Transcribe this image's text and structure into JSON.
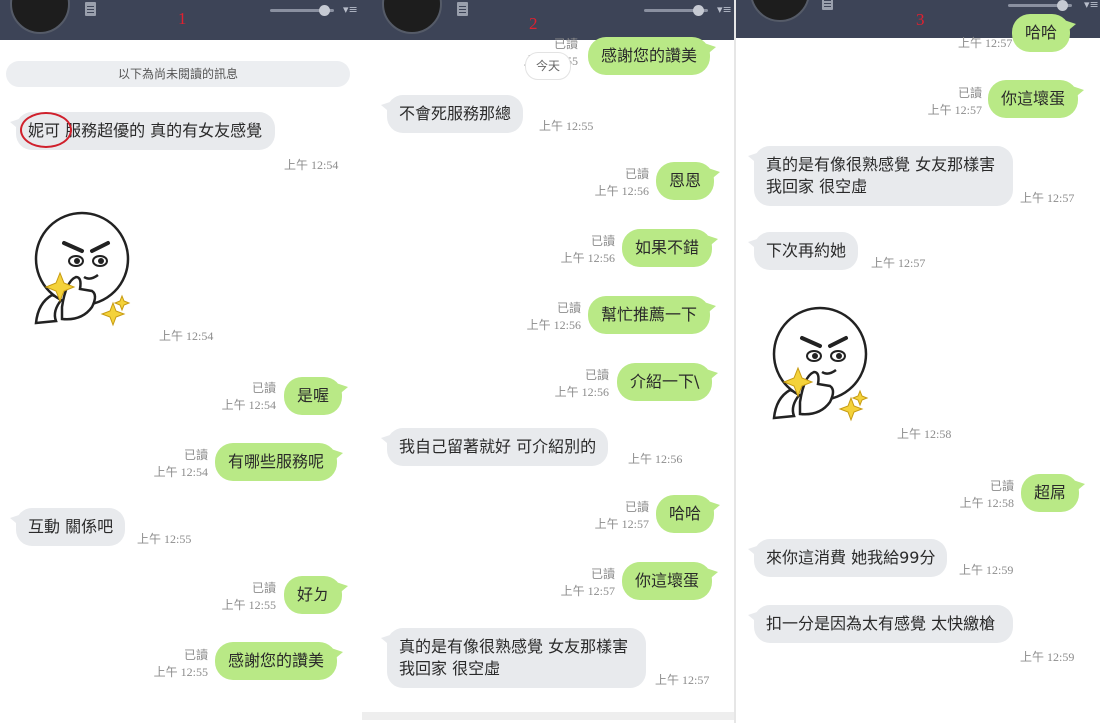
{
  "panel_numbers": [
    "1",
    "2",
    "3"
  ],
  "unread_divider": "以下為尚未閱讀的訊息",
  "date_divider": "今天",
  "icons": {
    "sticker": "smug-thumbs-up-sticker",
    "note": "note-icon",
    "avatar": "avatar"
  },
  "colors": {
    "header": "#3d4457",
    "outgoing": "#b9e986",
    "incoming": "#e8eaed",
    "annotation": "#d0202c"
  },
  "panel1": {
    "messages": [
      {
        "dir": "in",
        "text": "妮可 服務超優的 真的有女友感覺",
        "time": "上午 12:54"
      },
      {
        "dir": "in",
        "sticker": "smug-thumbs-up",
        "time": "上午 12:54"
      },
      {
        "dir": "out",
        "text": "是喔",
        "read": "已讀",
        "time": "上午 12:54"
      },
      {
        "dir": "out",
        "text": "有哪些服務呢",
        "read": "已讀",
        "time": "上午 12:54"
      },
      {
        "dir": "in",
        "text": "互動 關係吧",
        "time": "上午 12:55"
      },
      {
        "dir": "out",
        "text": "好ㄉ",
        "read": "已讀",
        "time": "上午 12:55"
      },
      {
        "dir": "out",
        "text": "感謝您的讚美",
        "read": "已讀",
        "time": "上午 12:55"
      }
    ]
  },
  "panel2": {
    "messages": [
      {
        "dir": "out",
        "text": "感謝您的讚美",
        "read": "已讀",
        "time": "上午 12:55"
      },
      {
        "dir": "in",
        "text": "不會死服務那總",
        "time": "上午 12:55"
      },
      {
        "dir": "out",
        "text": "恩恩",
        "read": "已讀",
        "time": "上午 12:56"
      },
      {
        "dir": "out",
        "text": "如果不錯",
        "read": "已讀",
        "time": "上午 12:56"
      },
      {
        "dir": "out",
        "text": "幫忙推薦一下",
        "read": "已讀",
        "time": "上午 12:56"
      },
      {
        "dir": "out",
        "text": "介紹一下\\",
        "read": "已讀",
        "time": "上午 12:56"
      },
      {
        "dir": "in",
        "text": "我自己留著就好 可介紹別的",
        "time": "上午 12:56"
      },
      {
        "dir": "out",
        "text": "哈哈",
        "read": "已讀",
        "time": "上午 12:57"
      },
      {
        "dir": "out",
        "text": "你這壞蛋",
        "read": "已讀",
        "time": "上午 12:57"
      },
      {
        "dir": "in",
        "text": "真的是有像很熟感覺 女友那樣害我回家 很空虛",
        "time": "上午 12:57"
      }
    ]
  },
  "panel3": {
    "messages": [
      {
        "dir": "out",
        "text": "哈哈",
        "time": "上午 12:57"
      },
      {
        "dir": "out",
        "text": "你這壞蛋",
        "read": "已讀",
        "time": "上午 12:57"
      },
      {
        "dir": "in",
        "text": "真的是有像很熟感覺 女友那樣害我回家 很空虛",
        "time": "上午 12:57"
      },
      {
        "dir": "in",
        "text": "下次再約她",
        "time": "上午 12:57"
      },
      {
        "dir": "in",
        "sticker": "smug-thumbs-up",
        "time": "上午 12:58"
      },
      {
        "dir": "out",
        "text": "超屌",
        "read": "已讀",
        "time": "上午 12:58"
      },
      {
        "dir": "in",
        "text": "來你這消費 她我給99分",
        "time": "上午 12:59"
      },
      {
        "dir": "in",
        "text": "扣一分是因為太有感覺 太快繳槍",
        "time": "上午 12:59"
      }
    ]
  }
}
